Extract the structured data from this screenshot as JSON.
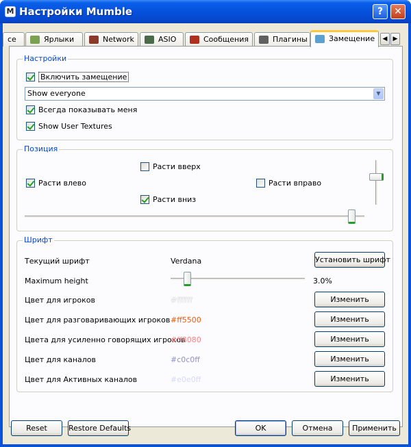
{
  "window": {
    "title": "Настройки Mumble",
    "app_icon_glyph": "M",
    "help_glyph": "?",
    "close_glyph": "✕"
  },
  "tabs": [
    {
      "label": "ce",
      "icon": "partial-tab-icon",
      "color": "#9b9b9b"
    },
    {
      "label": "Ярлыки",
      "icon": "shortcuts-icon",
      "color": "#7aa050"
    },
    {
      "label": "Network",
      "icon": "network-icon",
      "color": "#8a3a2a"
    },
    {
      "label": "ASIO",
      "icon": "asio-icon",
      "color": "#4a6a4a"
    },
    {
      "label": "Сообщения",
      "icon": "messages-icon",
      "color": "#b03020"
    },
    {
      "label": "Плагины",
      "icon": "plugins-icon",
      "color": "#606060"
    },
    {
      "label": "Замещение",
      "icon": "overlay-icon",
      "color": "#5aa0d0",
      "active": true
    }
  ],
  "tab_scroll": {
    "left": "◀",
    "right": "▶"
  },
  "settings_group": {
    "legend": "Настройки",
    "enable_overlay": {
      "label": "Включить замещение",
      "checked": true
    },
    "show_mode": {
      "value": "Show everyone"
    },
    "always_show_me": {
      "label": "Всегда показывать меня",
      "checked": true
    },
    "show_user_textures": {
      "label": "Show User Textures",
      "checked": true
    }
  },
  "position_group": {
    "legend": "Позиция",
    "grow_up": {
      "label": "Расти вверх",
      "checked": false
    },
    "grow_left": {
      "label": "Расти влево",
      "checked": true
    },
    "grow_right": {
      "label": "Расти вправо",
      "checked": false
    },
    "grow_down": {
      "label": "Расти вниз",
      "checked": true
    },
    "vertical_position_value": 0.85,
    "horizontal_position_value": 0.97
  },
  "font_group": {
    "legend": "Шрифт",
    "current_font_label": "Текущий шрифт",
    "current_font_value": "Verdana",
    "set_font_button": "Установить шрифт",
    "max_height_label": "Maximum height",
    "max_height_value": "3.0%",
    "max_height_slider": 0.1,
    "colors": [
      {
        "label": "Цвет для игроков",
        "value": "#ffffff",
        "button": "Изменить"
      },
      {
        "label": "Цвет для разговаривающих игроков",
        "value": "#ff5500",
        "button": "Изменить"
      },
      {
        "label": "Цвета для усиленно говорящих игроков",
        "value": "#ff8080",
        "button": "Изменить"
      },
      {
        "label": "Цвет для каналов",
        "value": "#c0c0ff",
        "button": "Изменить"
      },
      {
        "label": "Цвет для Активных каналов",
        "value": "#e0e0ff",
        "button": "Изменить"
      }
    ]
  },
  "bottom": {
    "reset": "Reset",
    "restore_defaults": "Restore Defaults",
    "ok": "OK",
    "cancel": "Отмена",
    "apply": "Применить"
  }
}
